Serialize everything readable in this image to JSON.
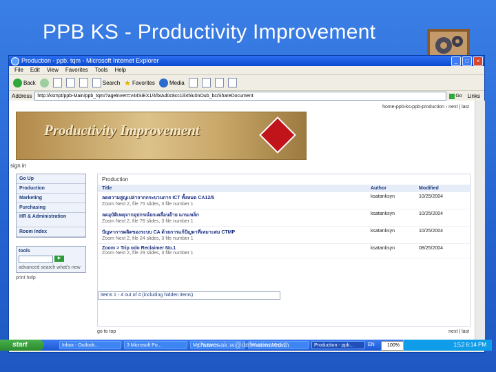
{
  "slide": {
    "title": "PPB KS - Productivity Improvement",
    "footer_email": "chuwesak.w@defmarina.co.th",
    "page_number": "152"
  },
  "window": {
    "title": "Production - ppb. tqm - Microsoft Internet Explorer",
    "menu": [
      "File",
      "Edit",
      "View",
      "Favorites",
      "Tools",
      "Help"
    ],
    "toolbar": {
      "back": "Back",
      "search": "Search",
      "favorites": "Favorites",
      "media": "Media"
    },
    "address_label": "Address",
    "address_value": "http://ksmpt/ppb-Main/ppb_tqm/?agelnvert=v44SiEX1/4/bIAd0c8cc1iil45lu0nOub_bc/ShareDocument",
    "go_label": "Go",
    "links_label": "Links"
  },
  "page": {
    "crumbs": "home›ppb›ks›ppb›production › next | last",
    "banner": "Productivity Improvement",
    "sign_in": "sign in",
    "nav": [
      "Go Up",
      "Production",
      "Marketing",
      "Purchasing",
      "HR & Administration",
      "Room Index"
    ],
    "tools_label": "tools",
    "tools_links": "advanced search  what's new",
    "print_help": "print   help",
    "main_heading": "Production",
    "columns": [
      "Title",
      "Author",
      "Modified"
    ],
    "rows": [
      {
        "title": "ลดความสูญเปล่าจากกระบวนการ ICT ทั้งหมด CA12/5",
        "sub": "Zoom Next 2, file 75 slides, 3 file number 1",
        "author": "ksatanksyn",
        "modified": "10/25/2004"
      },
      {
        "title": "ลดอุบัติเหตุจากอุปกรณ์ยกเคลื่อนย้าย แกนเหล็ก",
        "sub": "Zoom Next 2, file 76 slides, 3 file number 1",
        "author": "ksatanksyn",
        "modified": "10/25/2004"
      },
      {
        "title": "ปัญหาการผลิตของระบบ CA ด้วยการแก้ปัญหาที่เหมาะสม CTMP",
        "sub": "Zoom Next 2, file 24 slides, 3 file number 1",
        "author": "ksatanksyn",
        "modified": "10/25/2004"
      },
      {
        "title": "Zoom > Trip odo Reclaimer No.1",
        "sub": "Zoom Next 2, file 29 slides, 3 file number 1",
        "author": "ksatanksyn",
        "modified": "08/25/2004"
      }
    ],
    "items_summary": "Items 1 - 4 out of 4 (including hidden items)",
    "go_to_top": "go to top",
    "next_last": "next | last"
  },
  "taskbar": {
    "start": "start",
    "tasks": [
      "Inbox - Outlook...",
      "3 Microsoft Po...",
      "My Pictures",
      "Windows Media...",
      "Production - ppb..."
    ],
    "language": "EN",
    "zoom": "100%",
    "clock": "6:14 PM"
  }
}
